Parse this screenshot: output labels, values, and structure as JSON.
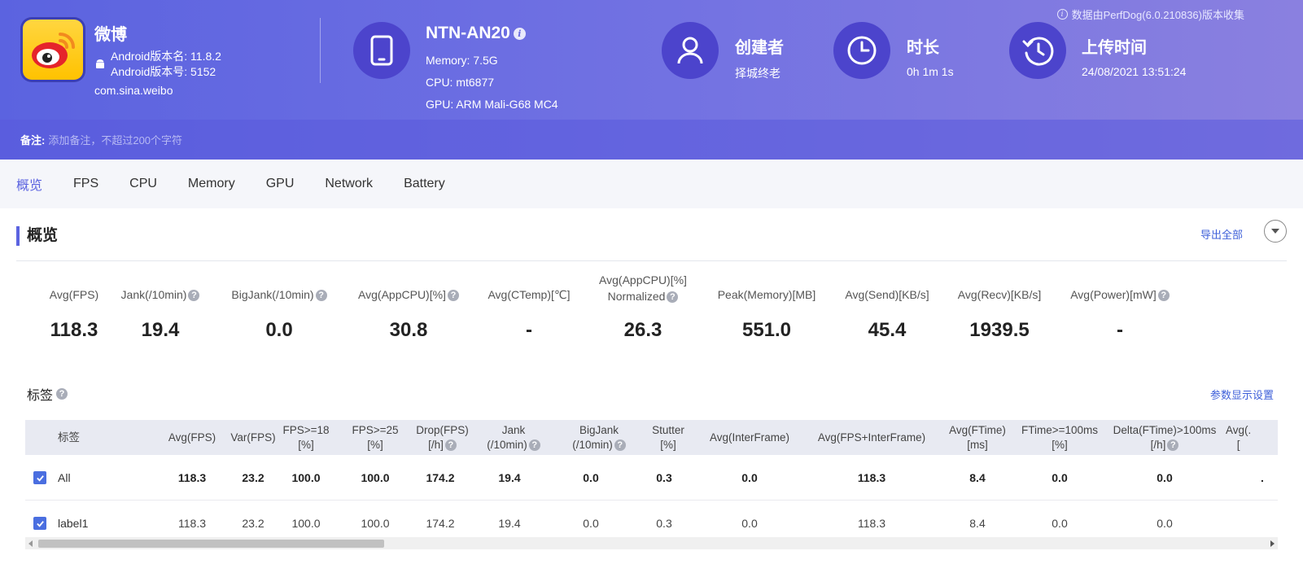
{
  "header": {
    "app_name": "微博",
    "android_version_name": "Android版本名: 11.8.2",
    "android_version_code": "Android版本号: 5152",
    "package": "com.sina.weibo",
    "device": {
      "name": "NTN-AN20",
      "memory": "Memory: 7.5G",
      "cpu": "CPU: mt6877",
      "gpu": "GPU: ARM Mali-G68 MC4"
    },
    "creator": {
      "title": "创建者",
      "value": "择城终老"
    },
    "duration": {
      "title": "时长",
      "value": "0h 1m 1s"
    },
    "upload": {
      "title": "上传时间",
      "value": "24/08/2021 13:51:24"
    },
    "source_note": "数据由PerfDog(6.0.210836)版本收集",
    "note_label": "备注:",
    "note_placeholder": "添加备注，不超过200个字符"
  },
  "tabs": [
    "概览",
    "FPS",
    "CPU",
    "Memory",
    "GPU",
    "Network",
    "Battery"
  ],
  "overview": {
    "title": "概览",
    "export_label": "导出全部",
    "stats": [
      {
        "label": "Avg(FPS)",
        "value": "118.3"
      },
      {
        "label": "Jank(/10min)",
        "value": "19.4"
      },
      {
        "label": "BigJank(/10min)",
        "value": "0.0"
      },
      {
        "label": "Avg(AppCPU)[%]",
        "value": "30.8"
      },
      {
        "label": "Avg(CTemp)[℃]",
        "value": "-"
      },
      {
        "label": "Avg(AppCPU)[%]",
        "label2": "Normalized",
        "value": "26.3"
      },
      {
        "label": "Peak(Memory)[MB]",
        "value": "551.0"
      },
      {
        "label": "Avg(Send)[KB/s]",
        "value": "45.4"
      },
      {
        "label": "Avg(Recv)[KB/s]",
        "value": "1939.5"
      },
      {
        "label": "Avg(Power)[mW]",
        "value": "-"
      }
    ]
  },
  "tags": {
    "title": "标签",
    "settings_label": "参数显示设置",
    "columns": [
      {
        "l1": "标签",
        "l2": ""
      },
      {
        "l1": "Avg(FPS)",
        "l2": ""
      },
      {
        "l1": "Var(FPS)",
        "l2": ""
      },
      {
        "l1": "FPS>=18",
        "l2": "[%]"
      },
      {
        "l1": "FPS>=25",
        "l2": "[%]"
      },
      {
        "l1": "Drop(FPS)",
        "l2": "[/h]"
      },
      {
        "l1": "Jank",
        "l2": "(/10min)"
      },
      {
        "l1": "BigJank",
        "l2": "(/10min)"
      },
      {
        "l1": "Stutter",
        "l2": "[%]"
      },
      {
        "l1": "Avg(InterFrame)",
        "l2": ""
      },
      {
        "l1": "Avg(FPS+InterFrame)",
        "l2": ""
      },
      {
        "l1": "Avg(FTime)",
        "l2": "[ms]"
      },
      {
        "l1": "FTime>=100ms",
        "l2": "[%]"
      },
      {
        "l1": "Delta(FTime)>100ms",
        "l2": "[/h]"
      },
      {
        "l1": "Avg(.",
        "l2": "["
      }
    ],
    "rows": [
      {
        "label": "All",
        "cells": [
          "118.3",
          "23.2",
          "100.0",
          "100.0",
          "174.2",
          "19.4",
          "0.0",
          "0.3",
          "0.0",
          "118.3",
          "8.4",
          "0.0",
          "0.0",
          "."
        ]
      },
      {
        "label": "label1",
        "cells": [
          "118.3",
          "23.2",
          "100.0",
          "100.0",
          "174.2",
          "19.4",
          "0.0",
          "0.3",
          "0.0",
          "118.3",
          "8.4",
          "0.0",
          "0.0",
          ""
        ]
      }
    ]
  },
  "colors": {
    "accent": "#5b63e0",
    "header_start": "#5b63e0",
    "header_end": "#8a80e0",
    "link": "#3d5fd9",
    "checkbox": "#4a6ee0"
  }
}
